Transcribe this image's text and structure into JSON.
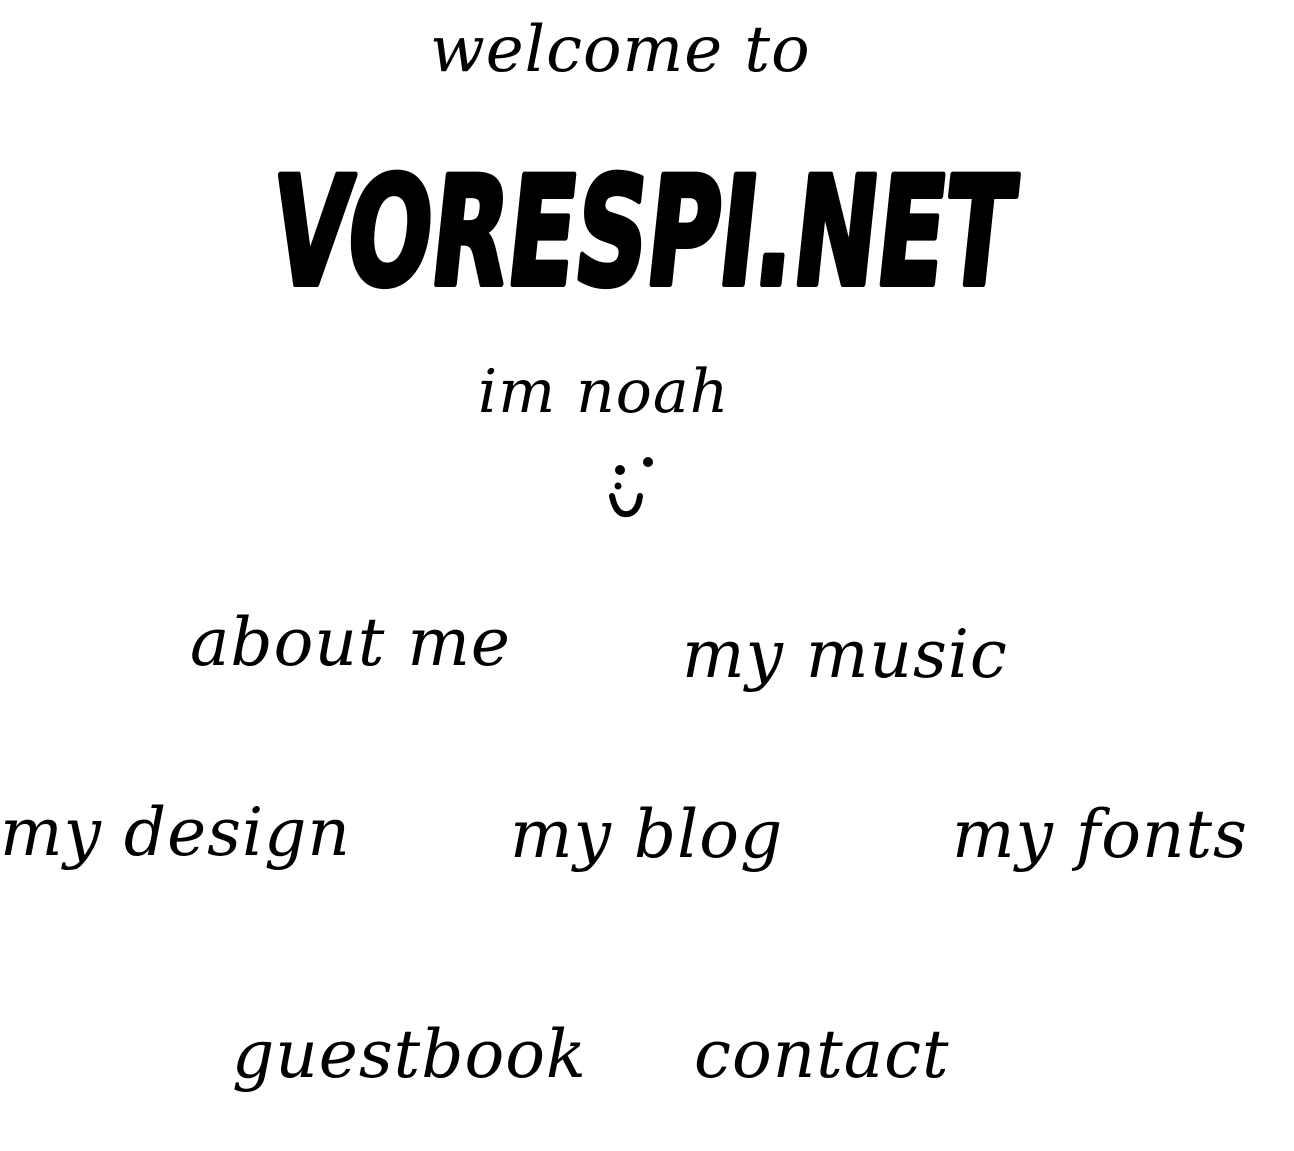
{
  "header": {
    "greeting": "welcome to",
    "logo_text": "VORESPI.NET",
    "intro": "im noah"
  },
  "icons": {
    "smiley": "smiley-face-icon"
  },
  "nav": {
    "about_me": "about me",
    "my_music": "my music",
    "my_design": "my design",
    "my_blog": "my blog",
    "my_fonts": "my fonts",
    "guestbook": "guestbook",
    "contact": "contact"
  },
  "colors": {
    "background": "#ffffff",
    "ink": "#000000"
  }
}
